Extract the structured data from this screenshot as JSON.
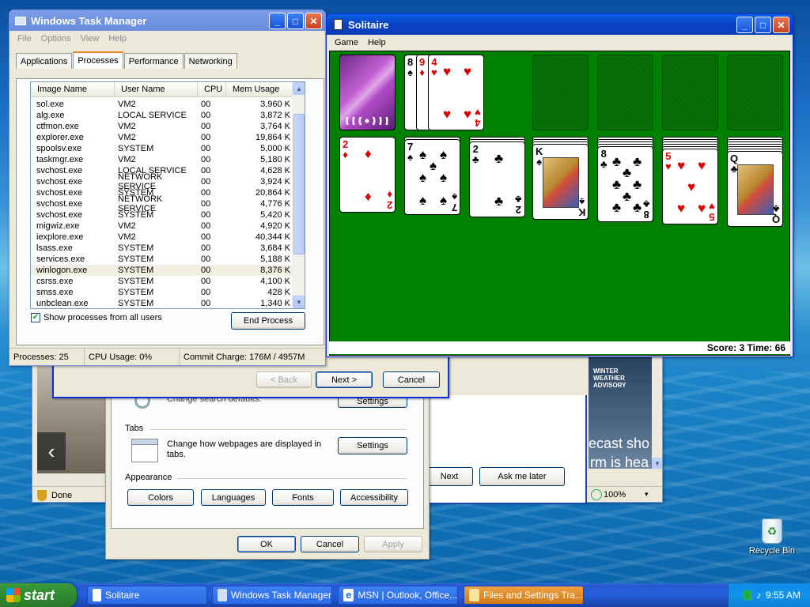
{
  "taskmanager": {
    "title": "Windows Task Manager",
    "menu": [
      "File",
      "Options",
      "View",
      "Help"
    ],
    "tabs": [
      "Applications",
      "Processes",
      "Performance",
      "Networking"
    ],
    "columns": [
      "Image Name",
      "User Name",
      "CPU",
      "Mem Usage"
    ],
    "rows": [
      [
        "sol.exe",
        "VM2",
        "00",
        "3,960 K"
      ],
      [
        "alg.exe",
        "LOCAL SERVICE",
        "00",
        "3,872 K"
      ],
      [
        "ctfmon.exe",
        "VM2",
        "00",
        "3,764 K"
      ],
      [
        "explorer.exe",
        "VM2",
        "00",
        "19,864 K"
      ],
      [
        "spoolsv.exe",
        "SYSTEM",
        "00",
        "5,000 K"
      ],
      [
        "taskmgr.exe",
        "VM2",
        "00",
        "5,180 K"
      ],
      [
        "svchost.exe",
        "LOCAL SERVICE",
        "00",
        "4,628 K"
      ],
      [
        "svchost.exe",
        "NETWORK SERVICE",
        "00",
        "3,924 K"
      ],
      [
        "svchost.exe",
        "SYSTEM",
        "00",
        "20,864 K"
      ],
      [
        "svchost.exe",
        "NETWORK SERVICE",
        "00",
        "4,776 K"
      ],
      [
        "svchost.exe",
        "SYSTEM",
        "00",
        "5,420 K"
      ],
      [
        "migwiz.exe",
        "VM2",
        "00",
        "4,920 K"
      ],
      [
        "iexplore.exe",
        "VM2",
        "00",
        "40,344 K"
      ],
      [
        "lsass.exe",
        "SYSTEM",
        "00",
        "3,684 K"
      ],
      [
        "services.exe",
        "SYSTEM",
        "00",
        "5,188 K"
      ],
      [
        "winlogon.exe",
        "SYSTEM",
        "00",
        "8,376 K"
      ],
      [
        "csrss.exe",
        "SYSTEM",
        "00",
        "4,100 K"
      ],
      [
        "smss.exe",
        "SYSTEM",
        "00",
        "428 K"
      ],
      [
        "unbclean.exe",
        "SYSTEM",
        "00",
        "1,340 K"
      ]
    ],
    "selected_row": 15,
    "show_all_label": "Show processes from all users",
    "show_all_checked": true,
    "end_process_label": "End Process",
    "status": {
      "processes": "Processes: 25",
      "cpu": "CPU Usage: 0%",
      "commit": "Commit Charge: 176M / 4957M"
    }
  },
  "solitaire": {
    "title": "Solitaire",
    "menu": [
      "Game",
      "Help"
    ],
    "score_text": "Score: 3 Time: 66",
    "waste": [
      {
        "rank": "8",
        "suit": "♠",
        "color": "black"
      },
      {
        "rank": "9",
        "suit": "♦",
        "color": "red"
      },
      {
        "rank": "4",
        "suit": "♥",
        "color": "red"
      }
    ],
    "tableau": [
      {
        "rank": "2",
        "suit": "♦",
        "color": "red"
      },
      {
        "rank": "7",
        "suit": "♠",
        "color": "black"
      },
      {
        "rank": "2",
        "suit": "♣",
        "color": "black"
      },
      {
        "rank": "K",
        "suit": "♠",
        "color": "black"
      },
      {
        "rank": "8",
        "suit": "♣",
        "color": "black"
      },
      {
        "rank": "5",
        "suit": "♥",
        "color": "red"
      },
      {
        "rank": "Q",
        "suit": "♣",
        "color": "black"
      }
    ]
  },
  "wizard": {
    "back": "< Back",
    "next": "Next >",
    "cancel": "Cancel"
  },
  "internet_options": {
    "search_desc": "Change search defaults.",
    "search_settings": "Settings",
    "tabs_section": "Tabs",
    "tabs_desc": "Change how webpages are displayed in tabs.",
    "tabs_settings": "Settings",
    "appearance_section": "Appearance",
    "colors": "Colors",
    "languages": "Languages",
    "fonts": "Fonts",
    "accessibility": "Accessibility",
    "ok": "OK",
    "cancel": "Cancel",
    "apply": "Apply"
  },
  "ie_window": {
    "status": "Done",
    "next": "Next",
    "ask_later": "Ask me later",
    "zoom": "100%",
    "forecast_text": "ecast sho",
    "forecast_text2": "rm is hea",
    "weather_label": "WINTER WEATHER ADVISORY"
  },
  "desktop": {
    "recycle_bin": "Recycle Bin"
  },
  "taskbar": {
    "start": "start",
    "items": [
      "Solitaire",
      "Windows Task Manager",
      "MSN | Outlook, Office...",
      "Files and Settings Tra..."
    ],
    "clock": "9:55 AM"
  },
  "colors": {
    "xp_blue": "#0a5fe6",
    "felt_green": "#008000",
    "start_green": "#3c9a3c"
  }
}
